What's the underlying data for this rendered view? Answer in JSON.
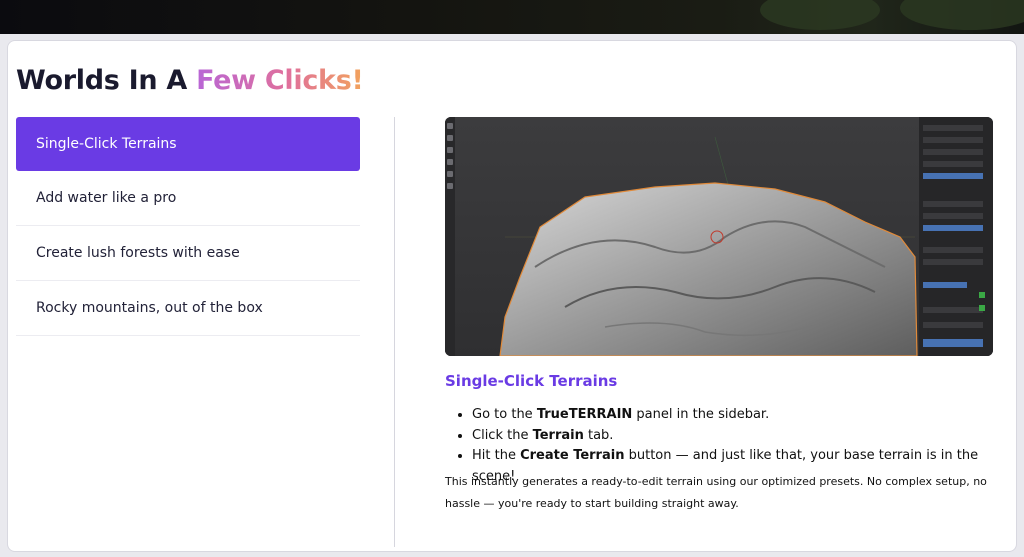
{
  "title": {
    "plain": "Worlds In A ",
    "highlight": "Few Clicks!"
  },
  "tabs": [
    {
      "label": "Single-Click Terrains",
      "active": true
    },
    {
      "label": "Add water like a pro",
      "active": false
    },
    {
      "label": "Create lush forests with ease",
      "active": false
    },
    {
      "label": "Rocky mountains, out of the box",
      "active": false
    }
  ],
  "detail": {
    "title": "Single-Click Terrains",
    "steps": [
      {
        "before": "Go to the ",
        "bold": "TrueTERRAIN",
        "after": " panel in the sidebar."
      },
      {
        "before": "Click the ",
        "bold": "Terrain",
        "after": " tab."
      },
      {
        "before": "Hit the ",
        "bold": "Create Terrain",
        "after": " button — and just like that, your base terrain is in the scene!"
      }
    ],
    "description": "This instantly generates a ready-to-edit terrain using our optimized presets. No complex setup, no hassle — you're ready to start building straight away."
  },
  "colors": {
    "accent": "#6a3be4",
    "gradient_start": "#b866d6",
    "gradient_end": "#f2a35c"
  }
}
